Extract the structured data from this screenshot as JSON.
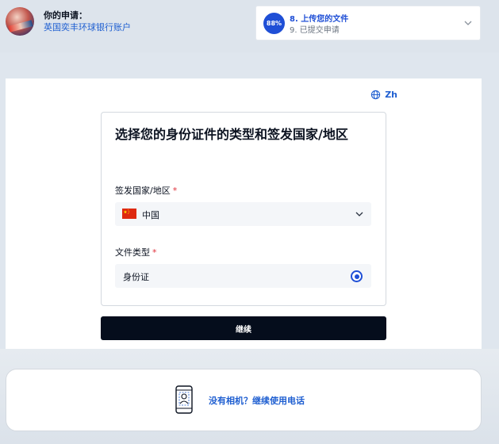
{
  "header": {
    "application_label": "你的申请：",
    "application_name": "英国奕丰环球银行账户",
    "progress": {
      "percent_label": "88%",
      "percent": 88,
      "current_step": "8. 上传您的文件",
      "next_step": "9. 已提交申请"
    }
  },
  "language": {
    "icon": "globe-icon",
    "label": "Zh"
  },
  "form": {
    "title": "选择您的身份证件的类型和签发国家/地区",
    "country_label": "签发国家/地区",
    "country_value": "中国",
    "document_type_label": "文件类型",
    "document_type_option": "身份证",
    "required_mark": "*"
  },
  "actions": {
    "continue_label": "继续"
  },
  "phone_option": {
    "icon": "phone-icon",
    "link_text": "没有相机？继续使用电话"
  },
  "colors": {
    "accent": "#1f4fd6",
    "link": "#1f5fd1",
    "button": "#050d1c",
    "required": "#e0303a"
  }
}
